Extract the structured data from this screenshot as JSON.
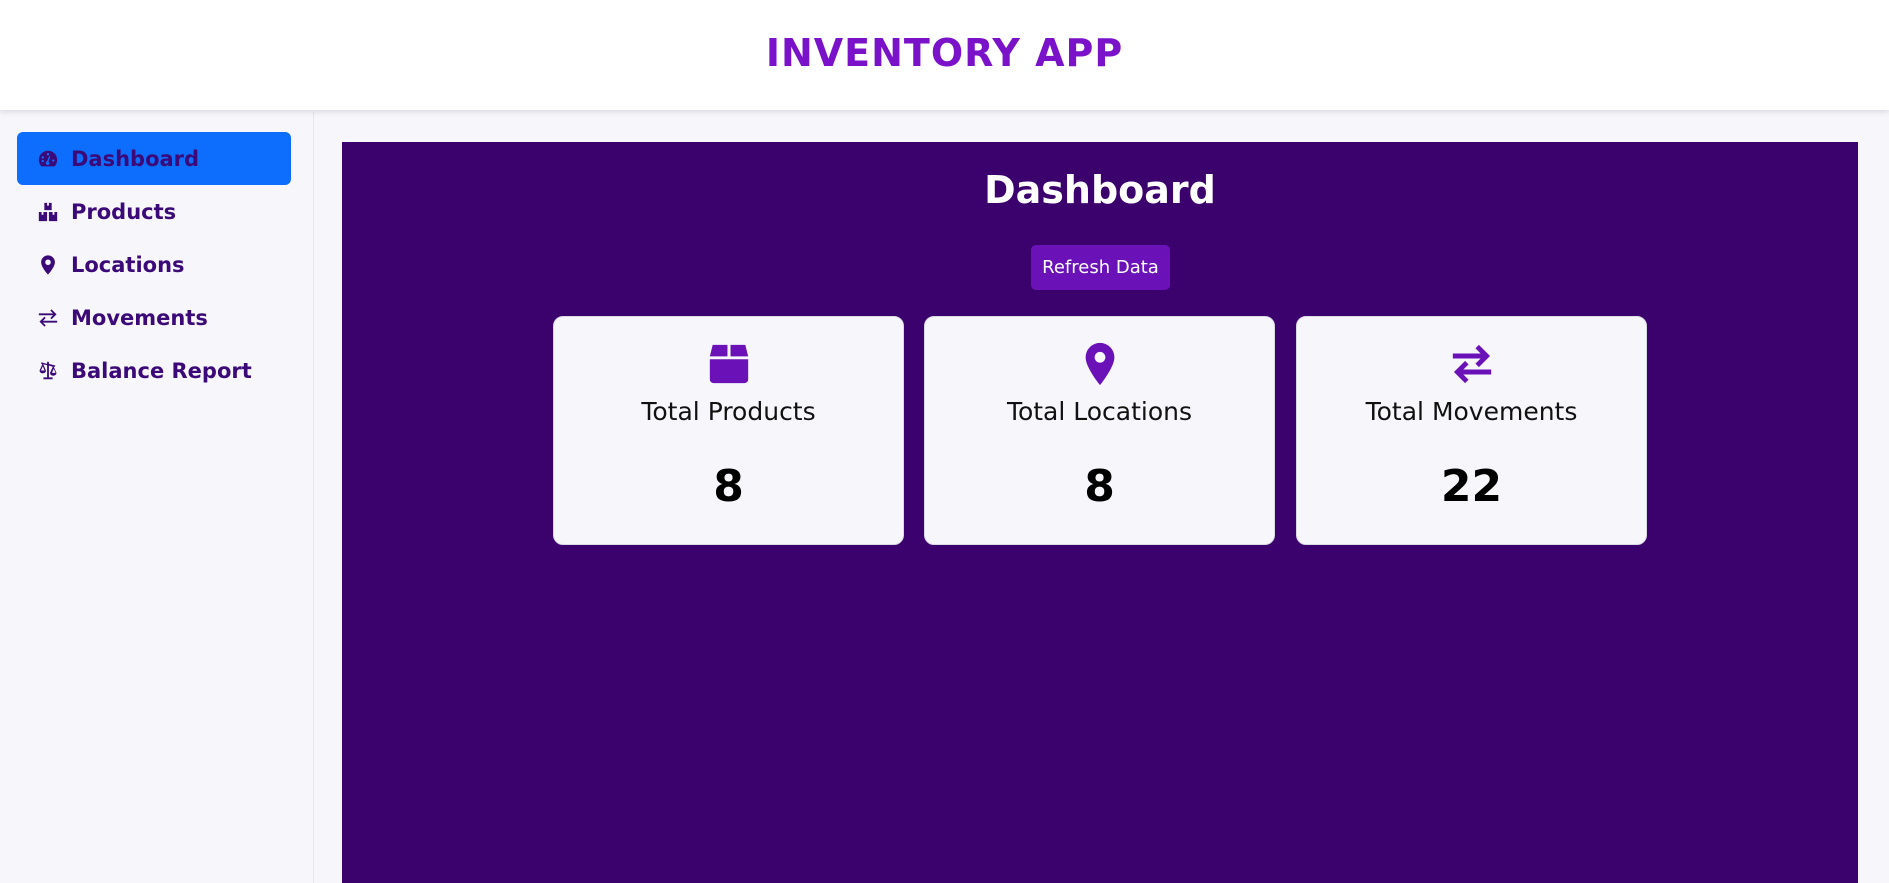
{
  "header": {
    "title": "INVENTORY APP"
  },
  "sidebar": {
    "items": [
      {
        "label": "Dashboard",
        "icon": "tachometer-icon",
        "active": true
      },
      {
        "label": "Products",
        "icon": "boxes-icon",
        "active": false
      },
      {
        "label": "Locations",
        "icon": "map-marker-icon",
        "active": false
      },
      {
        "label": "Movements",
        "icon": "exchange-icon",
        "active": false
      },
      {
        "label": "Balance Report",
        "icon": "balance-scale-icon",
        "active": false
      }
    ]
  },
  "main": {
    "title": "Dashboard",
    "refresh_label": "Refresh Data",
    "cards": [
      {
        "label": "Total Products",
        "value": "8",
        "icon": "box-icon"
      },
      {
        "label": "Total Locations",
        "value": "8",
        "icon": "map-marker-icon"
      },
      {
        "label": "Total Movements",
        "value": "22",
        "icon": "exchange-icon"
      }
    ]
  },
  "colors": {
    "brand": "#7a12c9",
    "panel_bg": "#3b016c",
    "active_nav": "#0d6efd",
    "accent": "#6a12b8",
    "nav_text": "#3b0a78"
  }
}
